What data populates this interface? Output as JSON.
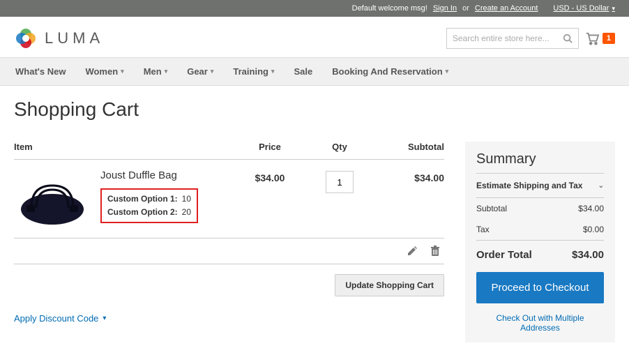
{
  "topbar": {
    "welcome": "Default welcome msg!",
    "signin": "Sign In",
    "or": "or",
    "create": "Create an Account",
    "currency": "USD - US Dollar"
  },
  "header": {
    "brand": "LUMA",
    "search_placeholder": "Search entire store here...",
    "cart_count": "1"
  },
  "nav": {
    "items": [
      {
        "label": "What's New",
        "drop": false
      },
      {
        "label": "Women",
        "drop": true
      },
      {
        "label": "Men",
        "drop": true
      },
      {
        "label": "Gear",
        "drop": true
      },
      {
        "label": "Training",
        "drop": true
      },
      {
        "label": "Sale",
        "drop": false
      },
      {
        "label": "Booking And Reservation",
        "drop": true
      }
    ]
  },
  "page": {
    "title": "Shopping Cart"
  },
  "cart": {
    "headers": {
      "item": "Item",
      "price": "Price",
      "qty": "Qty",
      "subtotal": "Subtotal"
    },
    "item": {
      "name": "Joust Duffle Bag",
      "options": [
        {
          "label": "Custom Option 1:",
          "value": "10"
        },
        {
          "label": "Custom Option 2:",
          "value": "20"
        }
      ],
      "price": "$34.00",
      "qty": "1",
      "subtotal": "$34.00"
    },
    "update_btn": "Update Shopping Cart",
    "discount_link": "Apply Discount Code"
  },
  "summary": {
    "title": "Summary",
    "estimate": "Estimate Shipping and Tax",
    "subtotal_label": "Subtotal",
    "subtotal_value": "$34.00",
    "tax_label": "Tax",
    "tax_value": "$0.00",
    "total_label": "Order Total",
    "total_value": "$34.00",
    "checkout_btn": "Proceed to Checkout",
    "multi_link": "Check Out with Multiple Addresses"
  }
}
